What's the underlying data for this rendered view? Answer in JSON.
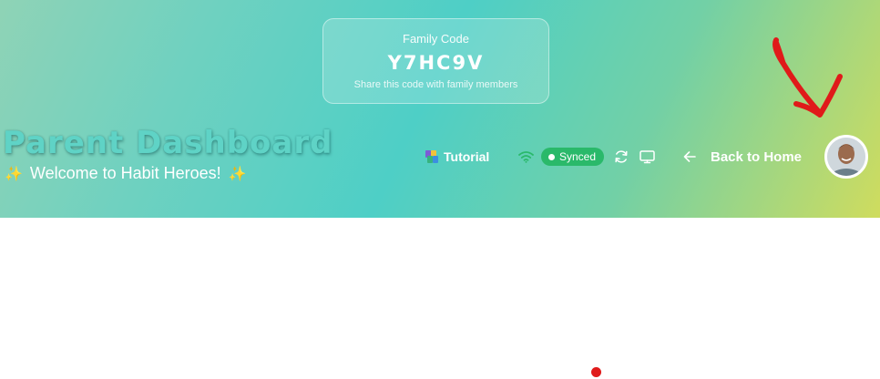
{
  "family": {
    "label": "Family Code",
    "code": "Y7HC9V",
    "hint": "Share this code with family members"
  },
  "header": {
    "title": "Parent Dashboard",
    "welcome": "Welcome to Habit Heroes!",
    "sparkle": "✨"
  },
  "toolbar": {
    "tutorial_label": "Tutorial",
    "sync_status": "Synced",
    "back_label": "Back to Home"
  },
  "icons": {
    "tutorial": "tutorial-icon",
    "connection": "wifi-icon",
    "refresh": "refresh-icon",
    "display": "monitor-icon",
    "back": "arrow-left-icon",
    "avatar": "user-avatar"
  },
  "colors": {
    "accent_green": "#2ab96a",
    "annotation_red": "#e01a1a",
    "title_teal": "#5fd3c6"
  }
}
